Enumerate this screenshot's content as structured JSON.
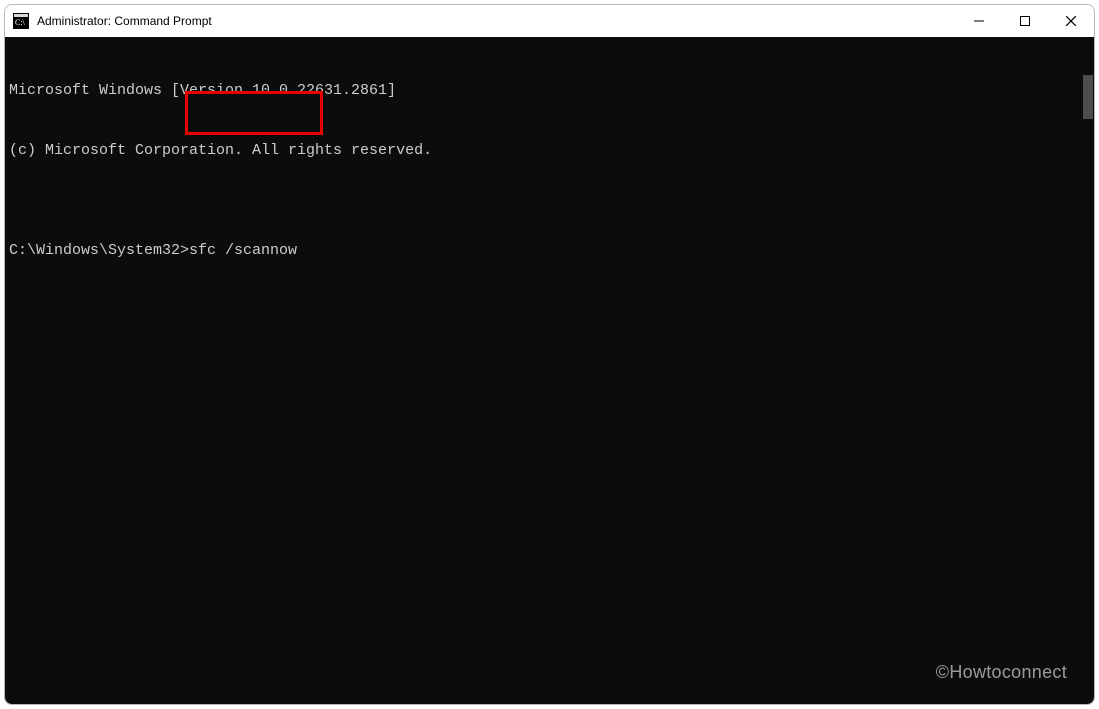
{
  "window": {
    "title": "Administrator: Command Prompt"
  },
  "terminal": {
    "line1": "Microsoft Windows [Version 10.0.22631.2861]",
    "line2": "(c) Microsoft Corporation. All rights reserved.",
    "blank": "",
    "prompt": "C:\\Windows\\System32>",
    "command": "sfc /scannow"
  },
  "highlight": {
    "color": "#e80000"
  },
  "watermark": "©Howtoconnect"
}
